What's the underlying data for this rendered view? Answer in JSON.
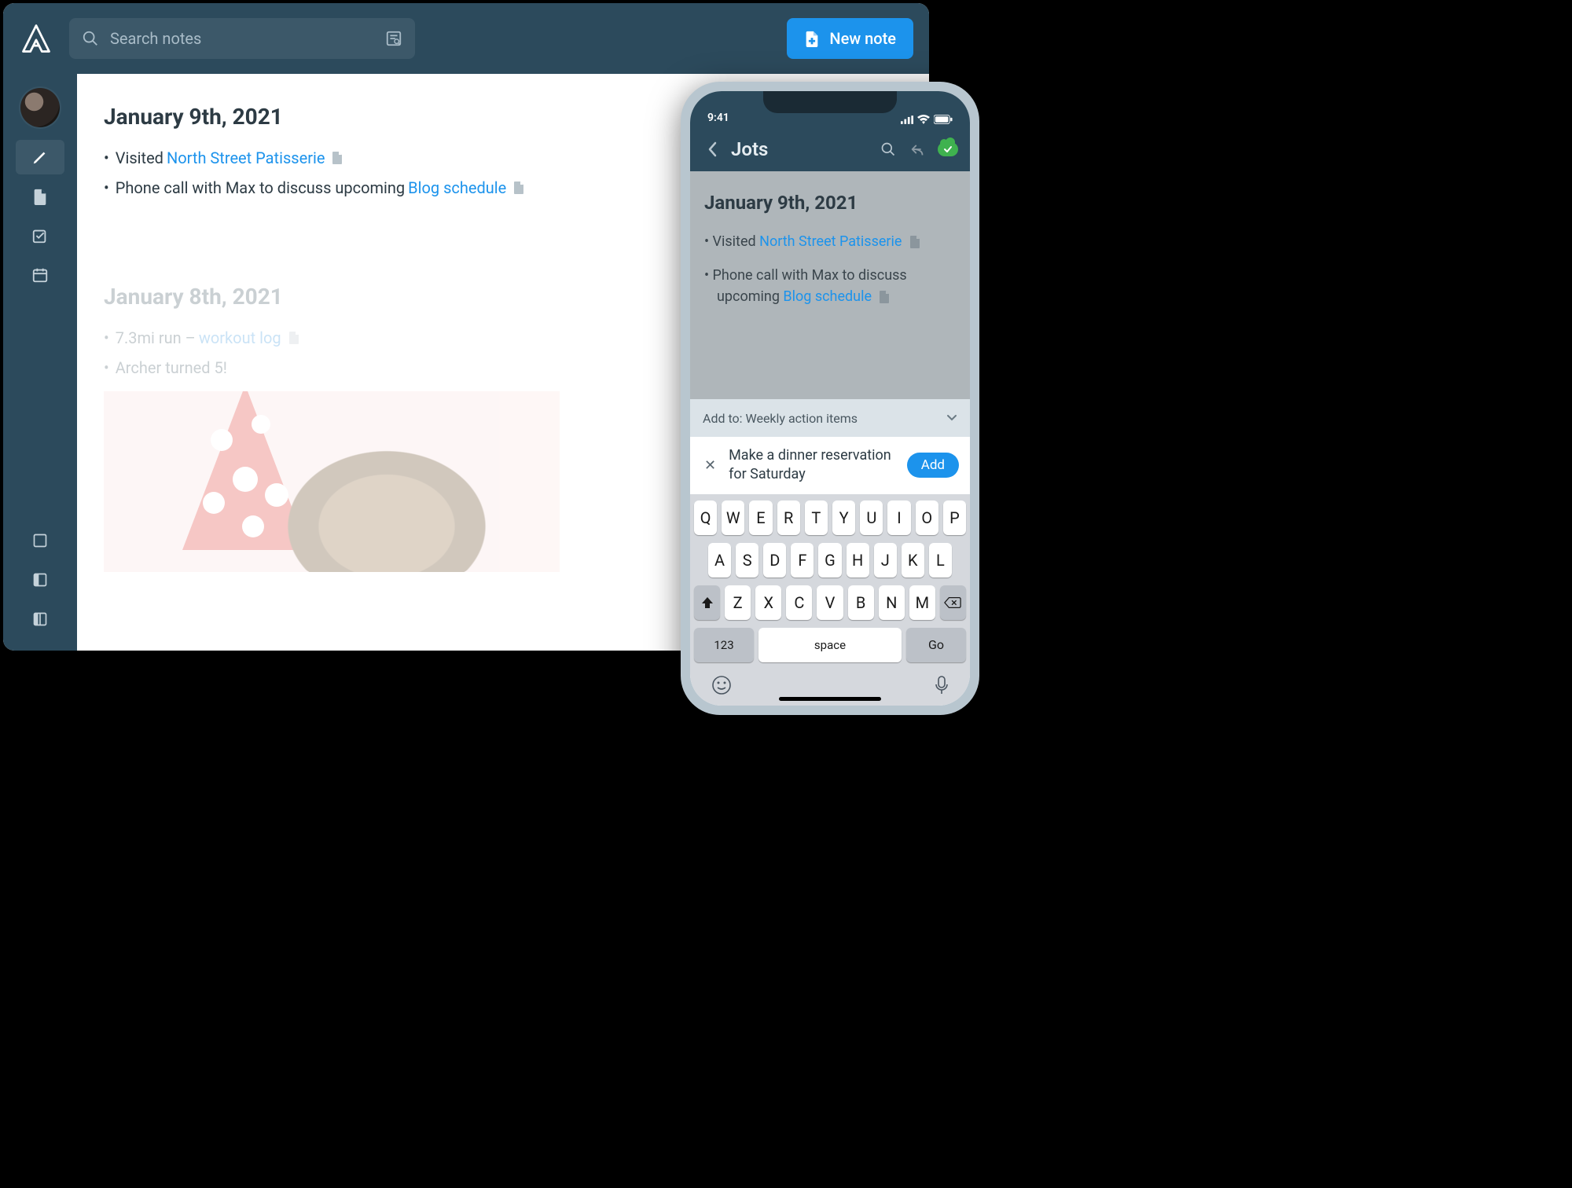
{
  "colors": {
    "accent": "#1c93ec",
    "bar": "#2c4a5c"
  },
  "desktop": {
    "search_placeholder": "Search notes",
    "new_note_label": "New note",
    "notes": [
      {
        "title": "January 9th, 2021",
        "lines": [
          {
            "prefix": "Visited ",
            "link": "North Street Patisserie",
            "suffix": ""
          },
          {
            "prefix": "Phone call with Max to discuss upcoming ",
            "link": "Blog schedule",
            "suffix": ""
          }
        ]
      },
      {
        "title": "January 8th, 2021",
        "lines": [
          {
            "prefix": "7.3mi run – ",
            "link": "workout log",
            "suffix": ""
          },
          {
            "prefix": "Archer turned 5!",
            "link": "",
            "suffix": ""
          }
        ]
      }
    ]
  },
  "phone": {
    "status_time": "9:41",
    "header_title": "Jots",
    "note": {
      "title": "January 9th, 2021",
      "lines": [
        {
          "prefix": "Visited ",
          "link": "North Street Patisserie",
          "suffix": ""
        },
        {
          "prefix": "Phone call with Max to discuss upcoming ",
          "link": "Blog schedule",
          "suffix": ""
        }
      ]
    },
    "addto_label": "Add to: Weekly action items",
    "input_text": "Make a dinner reservation for Saturday",
    "add_button": "Add",
    "keyboard": {
      "row1": [
        "Q",
        "W",
        "E",
        "R",
        "T",
        "Y",
        "U",
        "I",
        "O",
        "P"
      ],
      "row2": [
        "A",
        "S",
        "D",
        "F",
        "G",
        "H",
        "J",
        "K",
        "L"
      ],
      "row3": [
        "Z",
        "X",
        "C",
        "V",
        "B",
        "N",
        "M"
      ],
      "k123": "123",
      "space": "space",
      "go": "Go"
    }
  }
}
